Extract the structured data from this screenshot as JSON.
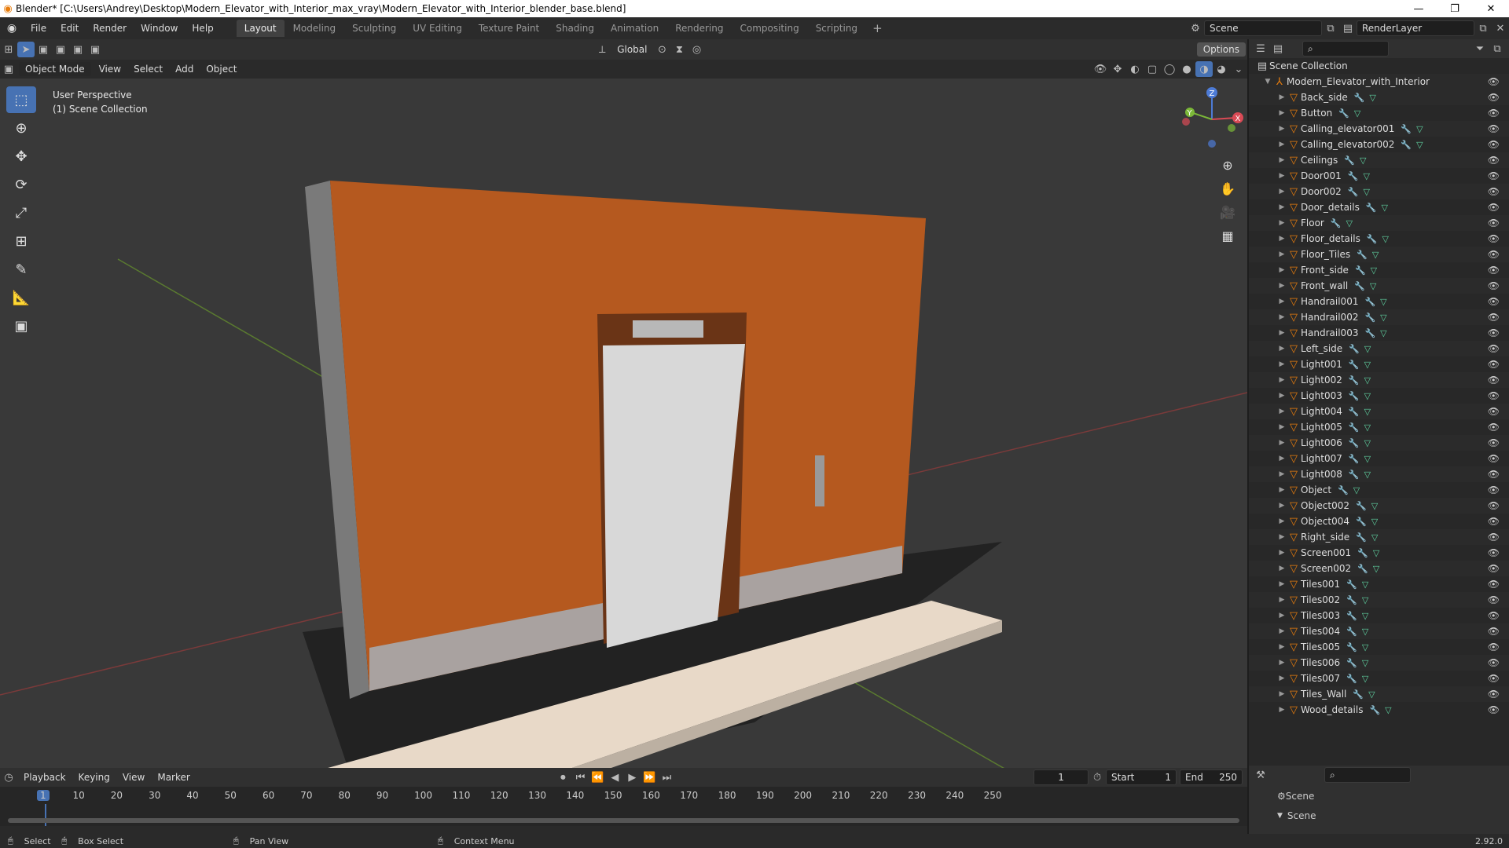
{
  "window": {
    "title": "Blender* [C:\\Users\\Andrey\\Desktop\\Modern_Elevator_with_Interior_max_vray\\Modern_Elevator_with_Interior_blender_base.blend]"
  },
  "menubar": {
    "items": [
      "File",
      "Edit",
      "Render",
      "Window",
      "Help"
    ]
  },
  "workspaces": {
    "tabs": [
      "Layout",
      "Modeling",
      "Sculpting",
      "UV Editing",
      "Texture Paint",
      "Shading",
      "Animation",
      "Rendering",
      "Compositing",
      "Scripting"
    ],
    "active": "Layout"
  },
  "scene": {
    "name": "Scene",
    "render_layer": "RenderLayer"
  },
  "viewport_header": {
    "transform": "Global",
    "options": "Options",
    "mode": "Object Mode",
    "menus": [
      "View",
      "Select",
      "Add",
      "Object"
    ]
  },
  "viewport": {
    "perspective": "User Perspective",
    "collection": "(1) Scene Collection"
  },
  "outliner": {
    "root": "Scene Collection",
    "collection": "Modern_Elevator_with_Interior",
    "objects": [
      "Back_side",
      "Button",
      "Calling_elevator001",
      "Calling_elevator002",
      "Ceilings",
      "Door001",
      "Door002",
      "Door_details",
      "Floor",
      "Floor_details",
      "Floor_Tiles",
      "Front_side",
      "Front_wall",
      "Handrail001",
      "Handrail002",
      "Handrail003",
      "Left_side",
      "Light001",
      "Light002",
      "Light003",
      "Light004",
      "Light005",
      "Light006",
      "Light007",
      "Light008",
      "Object",
      "Object002",
      "Object004",
      "Right_side",
      "Screen001",
      "Screen002",
      "Tiles001",
      "Tiles002",
      "Tiles003",
      "Tiles004",
      "Tiles005",
      "Tiles006",
      "Tiles007",
      "Tiles_Wall",
      "Wood_details"
    ]
  },
  "timeline": {
    "menus": [
      "Playback",
      "Keying",
      "View",
      "Marker"
    ],
    "current_frame": "1",
    "start_label": "Start",
    "start": "1",
    "end_label": "End",
    "end": "250",
    "ticks": [
      "1",
      "10",
      "20",
      "30",
      "40",
      "50",
      "60",
      "70",
      "80",
      "90",
      "100",
      "110",
      "120",
      "130",
      "140",
      "150",
      "160",
      "170",
      "180",
      "190",
      "200",
      "210",
      "220",
      "230",
      "240",
      "250"
    ]
  },
  "properties": {
    "scene": "Scene",
    "section": "Scene"
  },
  "status": {
    "select": "Select",
    "box_select": "Box Select",
    "pan_view": "Pan View",
    "context_menu": "Context Menu",
    "version": "2.92.0"
  },
  "colors": {
    "accent": "#4772b3",
    "wood": "#b5591f",
    "object_icon": "#e87d0d"
  }
}
